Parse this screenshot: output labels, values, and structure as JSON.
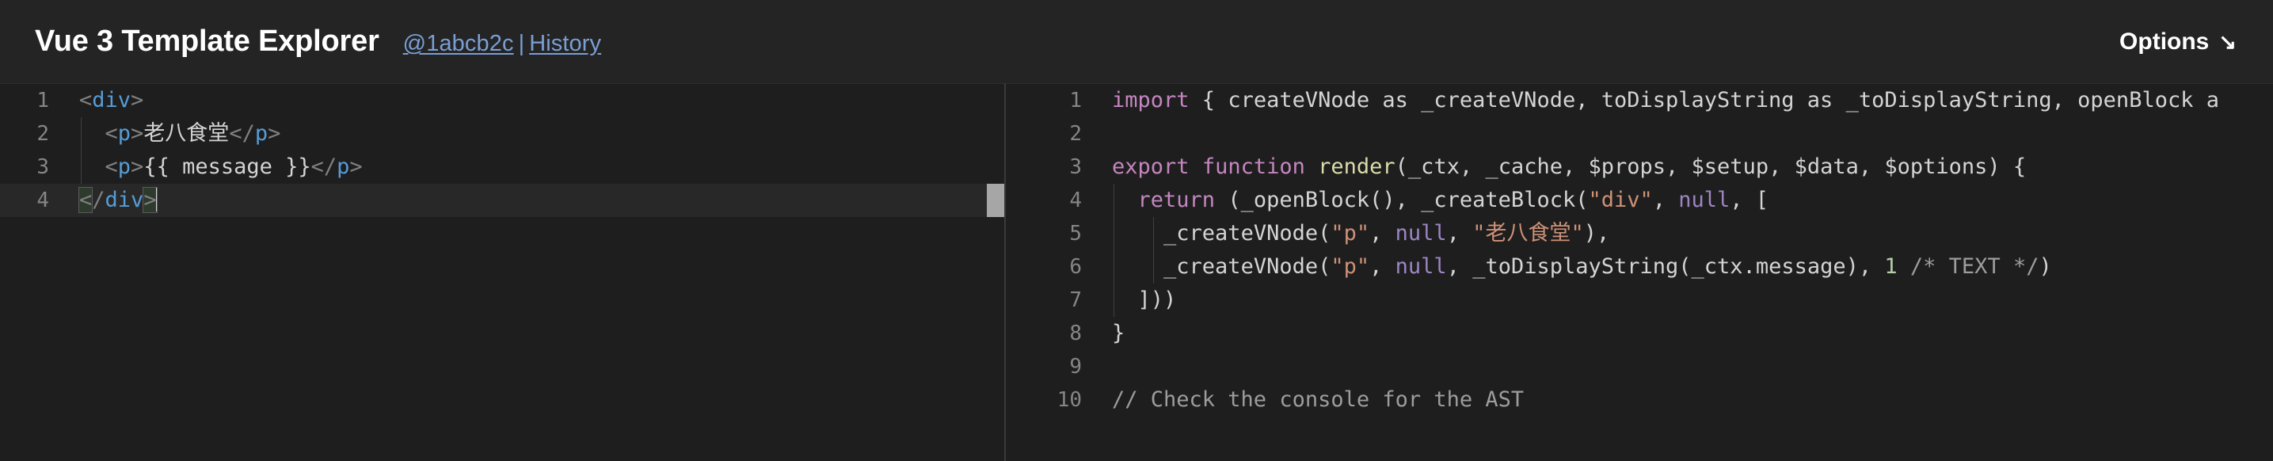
{
  "header": {
    "title": "Vue 3 Template Explorer",
    "commit_label": "@1abcb2c",
    "separator": "|",
    "history_label": "History",
    "options_label": "Options",
    "options_arrow": "↘"
  },
  "colors": {
    "header_bg": "#242424",
    "editor_bg": "#1e1e1e",
    "link": "#7a9fd4",
    "line_number": "#858585",
    "tag": "#569cd6",
    "punctuation": "#808080",
    "keyword": "#c586c0",
    "function": "#dcdcaa",
    "string": "#ce9178",
    "number": "#b5cea8",
    "comment": "#9d9d9d",
    "active_line": "#282828",
    "scrollbar_thumb": "#a6a6a6"
  },
  "source_editor": {
    "name": "vue-template-source",
    "language": "vue-html",
    "line_numbers": [
      "1",
      "2",
      "3",
      "4"
    ],
    "active_line": 4,
    "lines": [
      "<div>",
      "  <p>老八食堂</p>",
      "  <p>{{ message }}</p>",
      "</div>"
    ],
    "tokens": {
      "l1": {
        "open": "<",
        "tag": "div",
        "close": ">"
      },
      "l2": {
        "indent": "  ",
        "open": "<",
        "tag": "p",
        "gt": ">",
        "text": "老八食堂",
        "endopen": "</",
        "endtag": "p",
        "endgt": ">"
      },
      "l3": {
        "indent": "  ",
        "open": "<",
        "tag": "p",
        "gt": ">",
        "text": "{{ message }}",
        "endopen": "</",
        "endtag": "p",
        "endgt": ">"
      },
      "l4": {
        "open": "<",
        "slash": "/",
        "tag": "div",
        "close": ">"
      }
    }
  },
  "output_editor": {
    "name": "compiled-render-output",
    "language": "javascript",
    "line_numbers": [
      "1",
      "2",
      "3",
      "4",
      "5",
      "6",
      "7",
      "8",
      "9",
      "10"
    ],
    "lines": [
      "import { createVNode as _createVNode, toDisplayString as _toDisplayString, openBlock a",
      "",
      "export function render(_ctx, _cache, $props, $setup, $data, $options) {",
      "  return (_openBlock(), _createBlock(\"div\", null, [",
      "    _createVNode(\"p\", null, \"老八食堂\"),",
      "    _createVNode(\"p\", null, _toDisplayString(_ctx.message), 1 /* TEXT */)",
      "  ]))",
      "}",
      "",
      "// Check the console for the AST"
    ],
    "tokens": {
      "l1": {
        "kw_import": "import",
        "rest": " { createVNode as _createVNode, toDisplayString as _toDisplayString, openBlock a"
      },
      "l3": {
        "kw_export": "export",
        "kw_function": "function",
        "fn_name": "render",
        "params": "(_ctx, _cache, $props, $setup, $data, $options) {"
      },
      "l4": {
        "indent": "  ",
        "kw_return": "return",
        "mid": " (_openBlock(), _createBlock(",
        "str_div": "\"div\"",
        "comma": ", ",
        "kw_null": "null",
        "tail": ", ["
      },
      "l5": {
        "indent": "    ",
        "call": "_createVNode(",
        "str_p": "\"p\"",
        "comma1": ", ",
        "kw_null": "null",
        "comma2": ", ",
        "str_cn": "\"老八食堂\"",
        "tail": "),"
      },
      "l6": {
        "indent": "    ",
        "call": "_createVNode(",
        "str_p": "\"p\"",
        "comma1": ", ",
        "kw_null": "null",
        "mid": ", _toDisplayString(_ctx.message), ",
        "num": "1",
        "space": " ",
        "comment": "/* TEXT */",
        "tail": ")"
      },
      "l7": {
        "indent": "  ",
        "text": "]))"
      },
      "l8": {
        "text": "}"
      },
      "l10": {
        "comment": "// Check the console for the AST"
      }
    }
  }
}
